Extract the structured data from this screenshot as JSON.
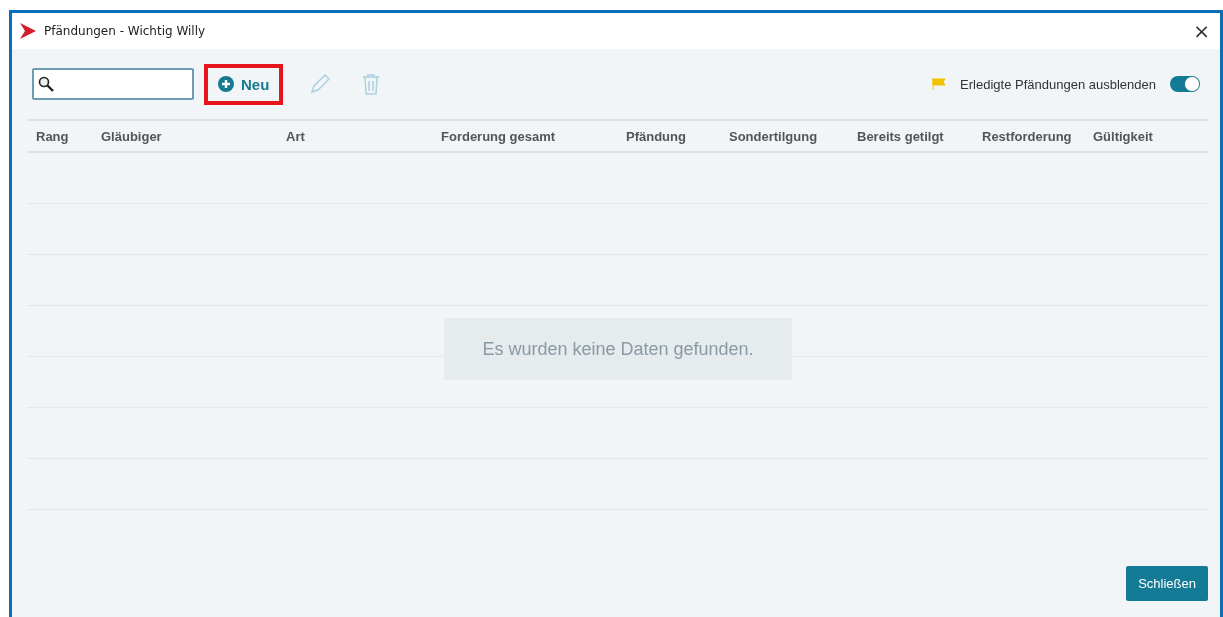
{
  "window": {
    "title": "Pfändungen - Wichtig Willy",
    "close": "×"
  },
  "toolbar": {
    "new_button": {
      "label": "Neu",
      "highlighted": true
    },
    "edit_disabled": true,
    "delete_disabled": true,
    "hide_done": {
      "label": "Erledigte Pfändungen ausblenden",
      "on": true
    }
  },
  "table": {
    "columns": [
      "Rang",
      "Gläubiger",
      "Art",
      "Forderung gesamt",
      "Pfändung",
      "Sondertilgung",
      "Bereits getilgt",
      "Restforderung",
      "Gültigkeit"
    ],
    "empty_message": "Es wurden keine Daten gefunden."
  },
  "buttons": [
    "Schließen"
  ]
}
